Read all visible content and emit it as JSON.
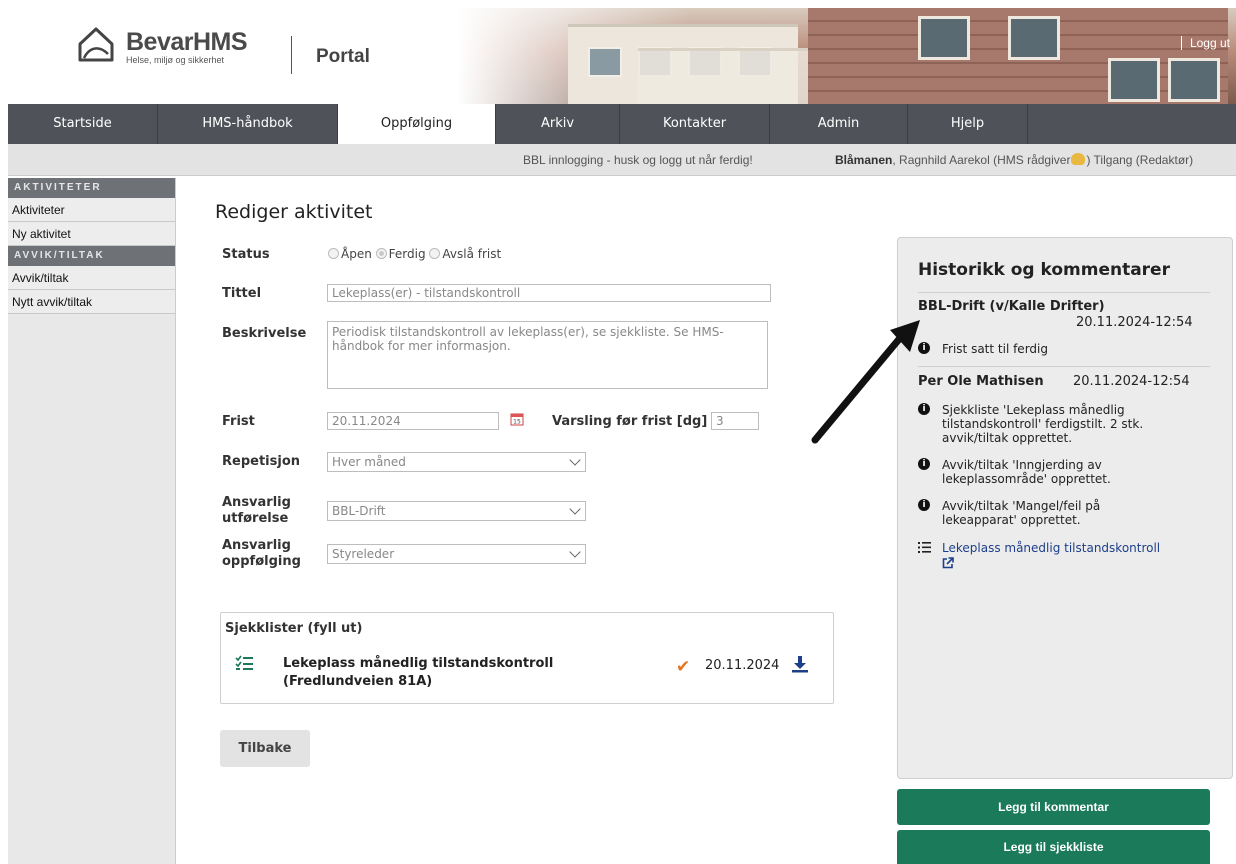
{
  "header": {
    "brand": "BevarHMS",
    "tagline": "Helse, miljø og sikkerhet",
    "portal": "Portal",
    "logout": "Logg ut"
  },
  "nav": {
    "tabs": [
      "Startside",
      "HMS-håndbok",
      "Oppfølging",
      "Arkiv",
      "Kontakter",
      "Admin",
      "Hjelp"
    ],
    "active": "Oppfølging"
  },
  "infobar": {
    "message": "BBL innlogging - husk og logg ut når ferdig!",
    "user_org": "Blåmanen",
    "user_rest_1": ", Ragnhild Aarekol (HMS rådgiver",
    "user_rest_2": ") Tilgang (Redaktør)"
  },
  "sidebar": {
    "section1": "AKTIVITETER",
    "items1": [
      "Aktiviteter",
      "Ny aktivitet"
    ],
    "section2": "AVVIK/TILTAK",
    "items2": [
      "Avvik/tiltak",
      "Nytt avvik/tiltak"
    ]
  },
  "form": {
    "title": "Rediger aktivitet",
    "status_label": "Status",
    "status_options": [
      "Åpen",
      "Ferdig",
      "Avslå frist"
    ],
    "status_selected": "Ferdig",
    "title_label": "Tittel",
    "title_value": "Lekeplass(er) - tilstandskontroll",
    "desc_label": "Beskrivelse",
    "desc_value": "Periodisk tilstandskontroll av lekeplass(er), se sjekkliste. Se HMS-håndbok for mer informasjon.",
    "deadline_label": "Frist",
    "deadline_value": "20.11.2024",
    "notify_label": "Varsling før frist [dg]",
    "notify_value": "3",
    "repeat_label": "Repetisjon",
    "repeat_value": "Hver måned",
    "resp_exec_label_1": "Ansvarlig",
    "resp_exec_label_2": "utførelse",
    "resp_exec_value": "BBL-Drift",
    "resp_follow_label_1": "Ansvarlig",
    "resp_follow_label_2": "oppfølging",
    "resp_follow_value": "Styreleder"
  },
  "checklists": {
    "heading": "Sjekklister (fyll ut)",
    "items": [
      {
        "name": "Lekeplass månedlig tilstandskontroll (Fredlundveien 81A)",
        "date": "20.11.2024",
        "done": true
      }
    ]
  },
  "back_button": "Tilbake",
  "history": {
    "title": "Historikk og kommentarer",
    "groups": [
      {
        "author": "BBL-Drift (v/Kalle Drifter)",
        "date": "20.11.2024-12:54",
        "entries": [
          {
            "icon": "info",
            "text": "Frist satt til ferdig"
          }
        ]
      },
      {
        "author": "Per Ole Mathisen",
        "date": "20.11.2024-12:54",
        "entries": [
          {
            "icon": "info",
            "text": "Sjekkliste 'Lekeplass månedlig tilstandskontroll' ferdigstilt. 2 stk. avvik/tiltak opprettet."
          },
          {
            "icon": "info",
            "text": "Avvik/tiltak 'Inngjerding av lekeplassområde' opprettet."
          },
          {
            "icon": "info",
            "text": "Avvik/tiltak 'Mangel/feil på lekeapparat' opprettet."
          },
          {
            "icon": "checklist",
            "text": "Lekeplass månedlig tilstandskontroll"
          }
        ]
      }
    ]
  },
  "actions": {
    "add_comment": "Legg til kommentar",
    "add_checklist": "Legg til sjekkliste"
  },
  "colors": {
    "nav_bg": "#4f5359",
    "action_green": "#1a7a5a",
    "check_orange": "#e8731f",
    "link_blue": "#1d3f8a"
  }
}
